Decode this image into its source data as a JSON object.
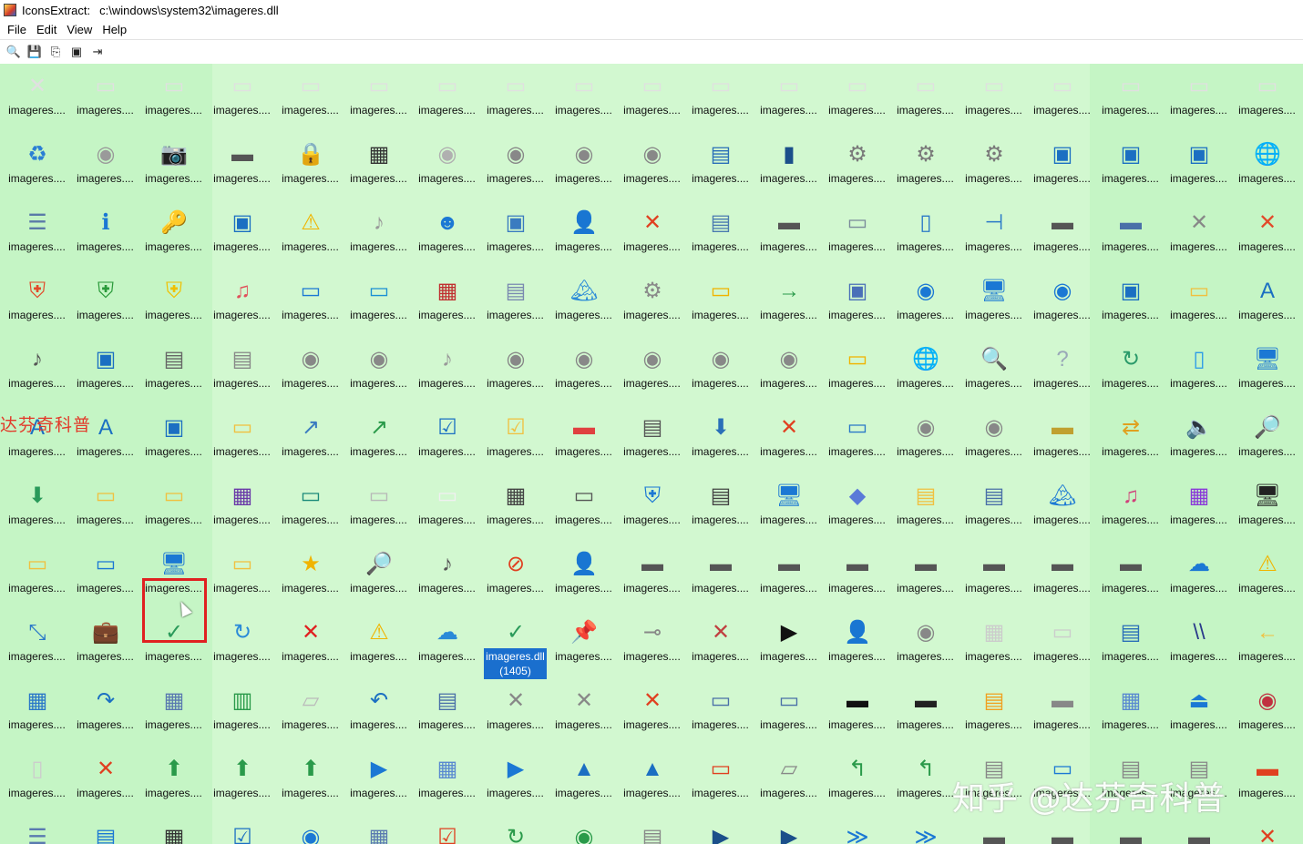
{
  "window": {
    "app_name": "IconsExtract:",
    "file_path": "c:\\windows\\system32\\imageres.dll"
  },
  "menu": [
    "File",
    "Edit",
    "View",
    "Help"
  ],
  "toolbar": [
    {
      "name": "search-icon",
      "glyph": "🔍"
    },
    {
      "name": "save-icon",
      "glyph": "💾"
    },
    {
      "name": "copy-icon",
      "glyph": "⎘"
    },
    {
      "name": "properties-icon",
      "glyph": "▣"
    },
    {
      "name": "exit-icon",
      "glyph": "⇥"
    }
  ],
  "grid": {
    "item_label": "imageres....",
    "selected": {
      "row": 8,
      "col": 7,
      "label_line1": "imageres.dll",
      "label_line2": "(1405)"
    },
    "highlight": {
      "row": 8,
      "col": 2
    },
    "rows": [
      [
        [
          "#e0e0e0",
          "✕"
        ],
        [
          "#e0e0e0",
          "▭"
        ],
        [
          "#e0e0e0",
          "▭"
        ],
        [
          "#e0e0e0",
          "▭"
        ],
        [
          "#e0e0e0",
          "▭"
        ],
        [
          "#e0e0e0",
          "▭"
        ],
        [
          "#e0e0e0",
          "▭"
        ],
        [
          "#e0e0e0",
          "▭"
        ],
        [
          "#e0e0e0",
          "▭"
        ],
        [
          "#e0e0e0",
          "▭"
        ],
        [
          "#e0e0e0",
          "▭"
        ],
        [
          "#e0e0e0",
          "▭"
        ],
        [
          "#e0e0e0",
          "▭"
        ],
        [
          "#e0e0e0",
          "▭"
        ],
        [
          "#e0e0e0",
          "▭"
        ],
        [
          "#e0e0e0",
          "▭"
        ],
        [
          "#e0e0e0",
          "▭"
        ],
        [
          "#e0e0e0",
          "▭"
        ],
        [
          "#e0e0e0",
          "▭"
        ]
      ],
      [
        [
          "#2a7fd4",
          "♻"
        ],
        [
          "#9a9a9a",
          "◉"
        ],
        [
          "#444",
          "📷"
        ],
        [
          "#555",
          "▬"
        ],
        [
          "#f0b400",
          "🔒"
        ],
        [
          "#333",
          "▦"
        ],
        [
          "#b0b0b0",
          "◉"
        ],
        [
          "#888",
          "◉"
        ],
        [
          "#888",
          "◉"
        ],
        [
          "#888",
          "◉"
        ],
        [
          "#2a6fb8",
          "▤"
        ],
        [
          "#1b4f8a",
          "▮"
        ],
        [
          "#7a7a7a",
          "⚙"
        ],
        [
          "#7a7a7a",
          "⚙"
        ],
        [
          "#7a7a7a",
          "⚙"
        ],
        [
          "#1b6fc2",
          "▣"
        ],
        [
          "#1b6fc2",
          "▣"
        ],
        [
          "#1b6fc2",
          "▣"
        ],
        [
          "#f0b400",
          "🌐"
        ]
      ],
      [
        [
          "#5a7aa8",
          "☰"
        ],
        [
          "#1b78d4",
          "ℹ"
        ],
        [
          "#f0b400",
          "🔑"
        ],
        [
          "#1b6fc2",
          "▣"
        ],
        [
          "#f0b400",
          "⚠"
        ],
        [
          "#999",
          "♪"
        ],
        [
          "#1b78d4",
          "☻"
        ],
        [
          "#3a7bc0",
          "▣"
        ],
        [
          "#17a87a",
          "👤"
        ],
        [
          "#e04020",
          "✕"
        ],
        [
          "#4a7ab0",
          "▤"
        ],
        [
          "#555",
          "▬"
        ],
        [
          "#7a8a9a",
          "▭"
        ],
        [
          "#2a78c8",
          "▯"
        ],
        [
          "#2a78c8",
          "⊣"
        ],
        [
          "#555",
          "▬"
        ],
        [
          "#4a70a8",
          "▬"
        ],
        [
          "#888",
          "✕"
        ],
        [
          "#e24a2a",
          "✕"
        ]
      ],
      [
        [
          "#e24a2a",
          "⛨"
        ],
        [
          "#2a9a3a",
          "⛨"
        ],
        [
          "#f0c000",
          "⛨"
        ],
        [
          "#e0505a",
          "♫"
        ],
        [
          "#1b78d4",
          "▭"
        ],
        [
          "#1b90d4",
          "▭"
        ],
        [
          "#c03030",
          "▦"
        ],
        [
          "#7a8ab0",
          "▤"
        ],
        [
          "#2a8ad8",
          "🏔"
        ],
        [
          "#8a8a8a",
          "⚙"
        ],
        [
          "#f0b400",
          "▭"
        ],
        [
          "#2a9a4a",
          "→"
        ],
        [
          "#4a70b8",
          "▣"
        ],
        [
          "#1b78d4",
          "◉"
        ],
        [
          "#1b78d4",
          "🖥"
        ],
        [
          "#1b78d4",
          "◉"
        ],
        [
          "#1b6fc2",
          "▣"
        ],
        [
          "#f0c040",
          "▭"
        ],
        [
          "#1b6fc2",
          "A"
        ]
      ],
      [
        [
          "#555",
          "♪"
        ],
        [
          "#1b6fc2",
          "▣"
        ],
        [
          "#666",
          "▤"
        ],
        [
          "#888",
          "▤"
        ],
        [
          "#888",
          "◉"
        ],
        [
          "#888",
          "◉"
        ],
        [
          "#999",
          "♪"
        ],
        [
          "#888",
          "◉"
        ],
        [
          "#888",
          "◉"
        ],
        [
          "#888",
          "◉"
        ],
        [
          "#888",
          "◉"
        ],
        [
          "#888",
          "◉"
        ],
        [
          "#f0b400",
          "▭"
        ],
        [
          "#2a6fb8",
          "🌐"
        ],
        [
          "#1b4f8a",
          "🔍"
        ],
        [
          "#9aa8b8",
          "?"
        ],
        [
          "#2a9a6a",
          "↻"
        ],
        [
          "#2a9ae8",
          "▯"
        ],
        [
          "#1b78d4",
          "🖥"
        ]
      ],
      [
        [
          "#1b6fc2",
          "A"
        ],
        [
          "#1b6fc2",
          "A"
        ],
        [
          "#1b6fc2",
          "▣"
        ],
        [
          "#f0c040",
          "▭"
        ],
        [
          "#3a7bc0",
          "↗"
        ],
        [
          "#2a9a4a",
          "↗"
        ],
        [
          "#1b6fc2",
          "☑"
        ],
        [
          "#f0c040",
          "☑"
        ],
        [
          "#e04040",
          "▬"
        ],
        [
          "#555",
          "▤"
        ],
        [
          "#2a6fb8",
          "⬇"
        ],
        [
          "#e04020",
          "✕"
        ],
        [
          "#2a78c8",
          "▭"
        ],
        [
          "#888",
          "◉"
        ],
        [
          "#888",
          "◉"
        ],
        [
          "#c0a030",
          "▬"
        ],
        [
          "#e0a020",
          "⇄"
        ],
        [
          "#2a78c8",
          "🔈"
        ],
        [
          "#1b6fc2",
          "🔎"
        ]
      ],
      [
        [
          "#2a9a5a",
          "⬇"
        ],
        [
          "#f0c040",
          "▭"
        ],
        [
          "#f0c040",
          "▭"
        ],
        [
          "#6a3aa8",
          "▦"
        ],
        [
          "#1a8a7a",
          "▭"
        ],
        [
          "#b8b8b8",
          "▭"
        ],
        [
          "#f0f0f0",
          "▭"
        ],
        [
          "#444",
          "▦"
        ],
        [
          "#555",
          "▭"
        ],
        [
          "#1b78d4",
          "⛨"
        ],
        [
          "#444",
          "▤"
        ],
        [
          "#1b78d4",
          "🖥"
        ],
        [
          "#5a7ad8",
          "◆"
        ],
        [
          "#f0c040",
          "▤"
        ],
        [
          "#4a70a8",
          "▤"
        ],
        [
          "#1b78d4",
          "🏔"
        ],
        [
          "#d0407a",
          "♫"
        ],
        [
          "#8a3ad8",
          "▦"
        ],
        [
          "#222",
          "🖥"
        ]
      ],
      [
        [
          "#f0c040",
          "▭"
        ],
        [
          "#1b78d4",
          "▭"
        ],
        [
          "#1b78d4",
          "🖥"
        ],
        [
          "#f0c040",
          "▭"
        ],
        [
          "#f0b400",
          "★"
        ],
        [
          "#f0c040",
          "🔎"
        ],
        [
          "#555",
          "♪"
        ],
        [
          "#e04020",
          "⊘"
        ],
        [
          "#17a87a",
          "👤"
        ],
        [
          "#555",
          "▬"
        ],
        [
          "#555",
          "▬"
        ],
        [
          "#555",
          "▬"
        ],
        [
          "#555",
          "▬"
        ],
        [
          "#555",
          "▬"
        ],
        [
          "#555",
          "▬"
        ],
        [
          "#555",
          "▬"
        ],
        [
          "#555",
          "▬"
        ],
        [
          "#1b78d4",
          "☁"
        ],
        [
          "#f0b400",
          "⚠"
        ]
      ],
      [
        [
          "#2a78c8",
          "⤡"
        ],
        [
          "#a86a10",
          "💼"
        ],
        [
          "#2a9a5a",
          "✓"
        ],
        [
          "#2a8ad8",
          "↻"
        ],
        [
          "#e02020",
          "✕"
        ],
        [
          "#f0b400",
          "⚠"
        ],
        [
          "#2a8ad8",
          "☁"
        ],
        [
          "#2a9a5a",
          "✓"
        ],
        [
          "#888",
          "📌"
        ],
        [
          "#888",
          "⊸"
        ],
        [
          "#c04040",
          "✕"
        ],
        [
          "#111",
          "▶"
        ],
        [
          "#17a87a",
          "👤"
        ],
        [
          "#888",
          "◉"
        ],
        [
          "#ccc",
          "▦"
        ],
        [
          "#ccc",
          "▭"
        ],
        [
          "#2a6fb8",
          "▤"
        ],
        [
          "#2a3a8a",
          "\\\\"
        ],
        [
          "#f0c040",
          "←"
        ]
      ],
      [
        [
          "#2a78c8",
          "▦"
        ],
        [
          "#1b6fc2",
          "↷"
        ],
        [
          "#5a7ab0",
          "▦"
        ],
        [
          "#2a9a4a",
          "▥"
        ],
        [
          "#bbb",
          "▱"
        ],
        [
          "#1b6fc2",
          "↶"
        ],
        [
          "#4a70a8",
          "▤"
        ],
        [
          "#888",
          "✕"
        ],
        [
          "#888",
          "✕"
        ],
        [
          "#e04020",
          "✕"
        ],
        [
          "#4a70a8",
          "▭"
        ],
        [
          "#4a70a8",
          "▭"
        ],
        [
          "#111",
          "▬"
        ],
        [
          "#222",
          "▬"
        ],
        [
          "#f0a020",
          "▤"
        ],
        [
          "#888",
          "▬"
        ],
        [
          "#5a8ad0",
          "▦"
        ],
        [
          "#1b78d4",
          "⏏"
        ],
        [
          "#c03040",
          "◉"
        ]
      ],
      [
        [
          "#ccc",
          "▯"
        ],
        [
          "#e04020",
          "✕"
        ],
        [
          "#2a9a4a",
          "⬆"
        ],
        [
          "#2a9a4a",
          "⬆"
        ],
        [
          "#2a9a4a",
          "⬆"
        ],
        [
          "#1b78d4",
          "▶"
        ],
        [
          "#5a8ad0",
          "▦"
        ],
        [
          "#1b78d4",
          "▶"
        ],
        [
          "#1b6fc2",
          "▲"
        ],
        [
          "#1b6fc2",
          "▲"
        ],
        [
          "#e04020",
          "▭"
        ],
        [
          "#888",
          "▱"
        ],
        [
          "#2a9a4a",
          "↰"
        ],
        [
          "#2a9a4a",
          "↰"
        ],
        [
          "#888",
          "▤"
        ],
        [
          "#1b78d4",
          "▭"
        ],
        [
          "#888",
          "▤"
        ],
        [
          "#888",
          "▤"
        ],
        [
          "#e04020",
          "▬"
        ]
      ],
      [
        [
          "#5a7ab0",
          "☰"
        ],
        [
          "#1b78d4",
          "▤"
        ],
        [
          "#333",
          "▦"
        ],
        [
          "#1b6fc2",
          "☑"
        ],
        [
          "#1b78d4",
          "◉"
        ],
        [
          "#5a7ab0",
          "▦"
        ],
        [
          "#e04020",
          "☑"
        ],
        [
          "#2a9a4a",
          "↻"
        ],
        [
          "#2a9a4a",
          "◉"
        ],
        [
          "#888",
          "▤"
        ],
        [
          "#1b4f8a",
          "▶"
        ],
        [
          "#1b4f8a",
          "▶"
        ],
        [
          "#1b78d4",
          "≫"
        ],
        [
          "#1b78d4",
          "≫"
        ],
        [
          "#555",
          "▬"
        ],
        [
          "#555",
          "▬"
        ],
        [
          "#555",
          "▬"
        ],
        [
          "#555",
          "▬"
        ],
        [
          "#e04020",
          "✕"
        ]
      ]
    ]
  },
  "watermarks": {
    "left": "达芬奇科普",
    "bottom_right": "知乎 @达芬奇科普"
  }
}
